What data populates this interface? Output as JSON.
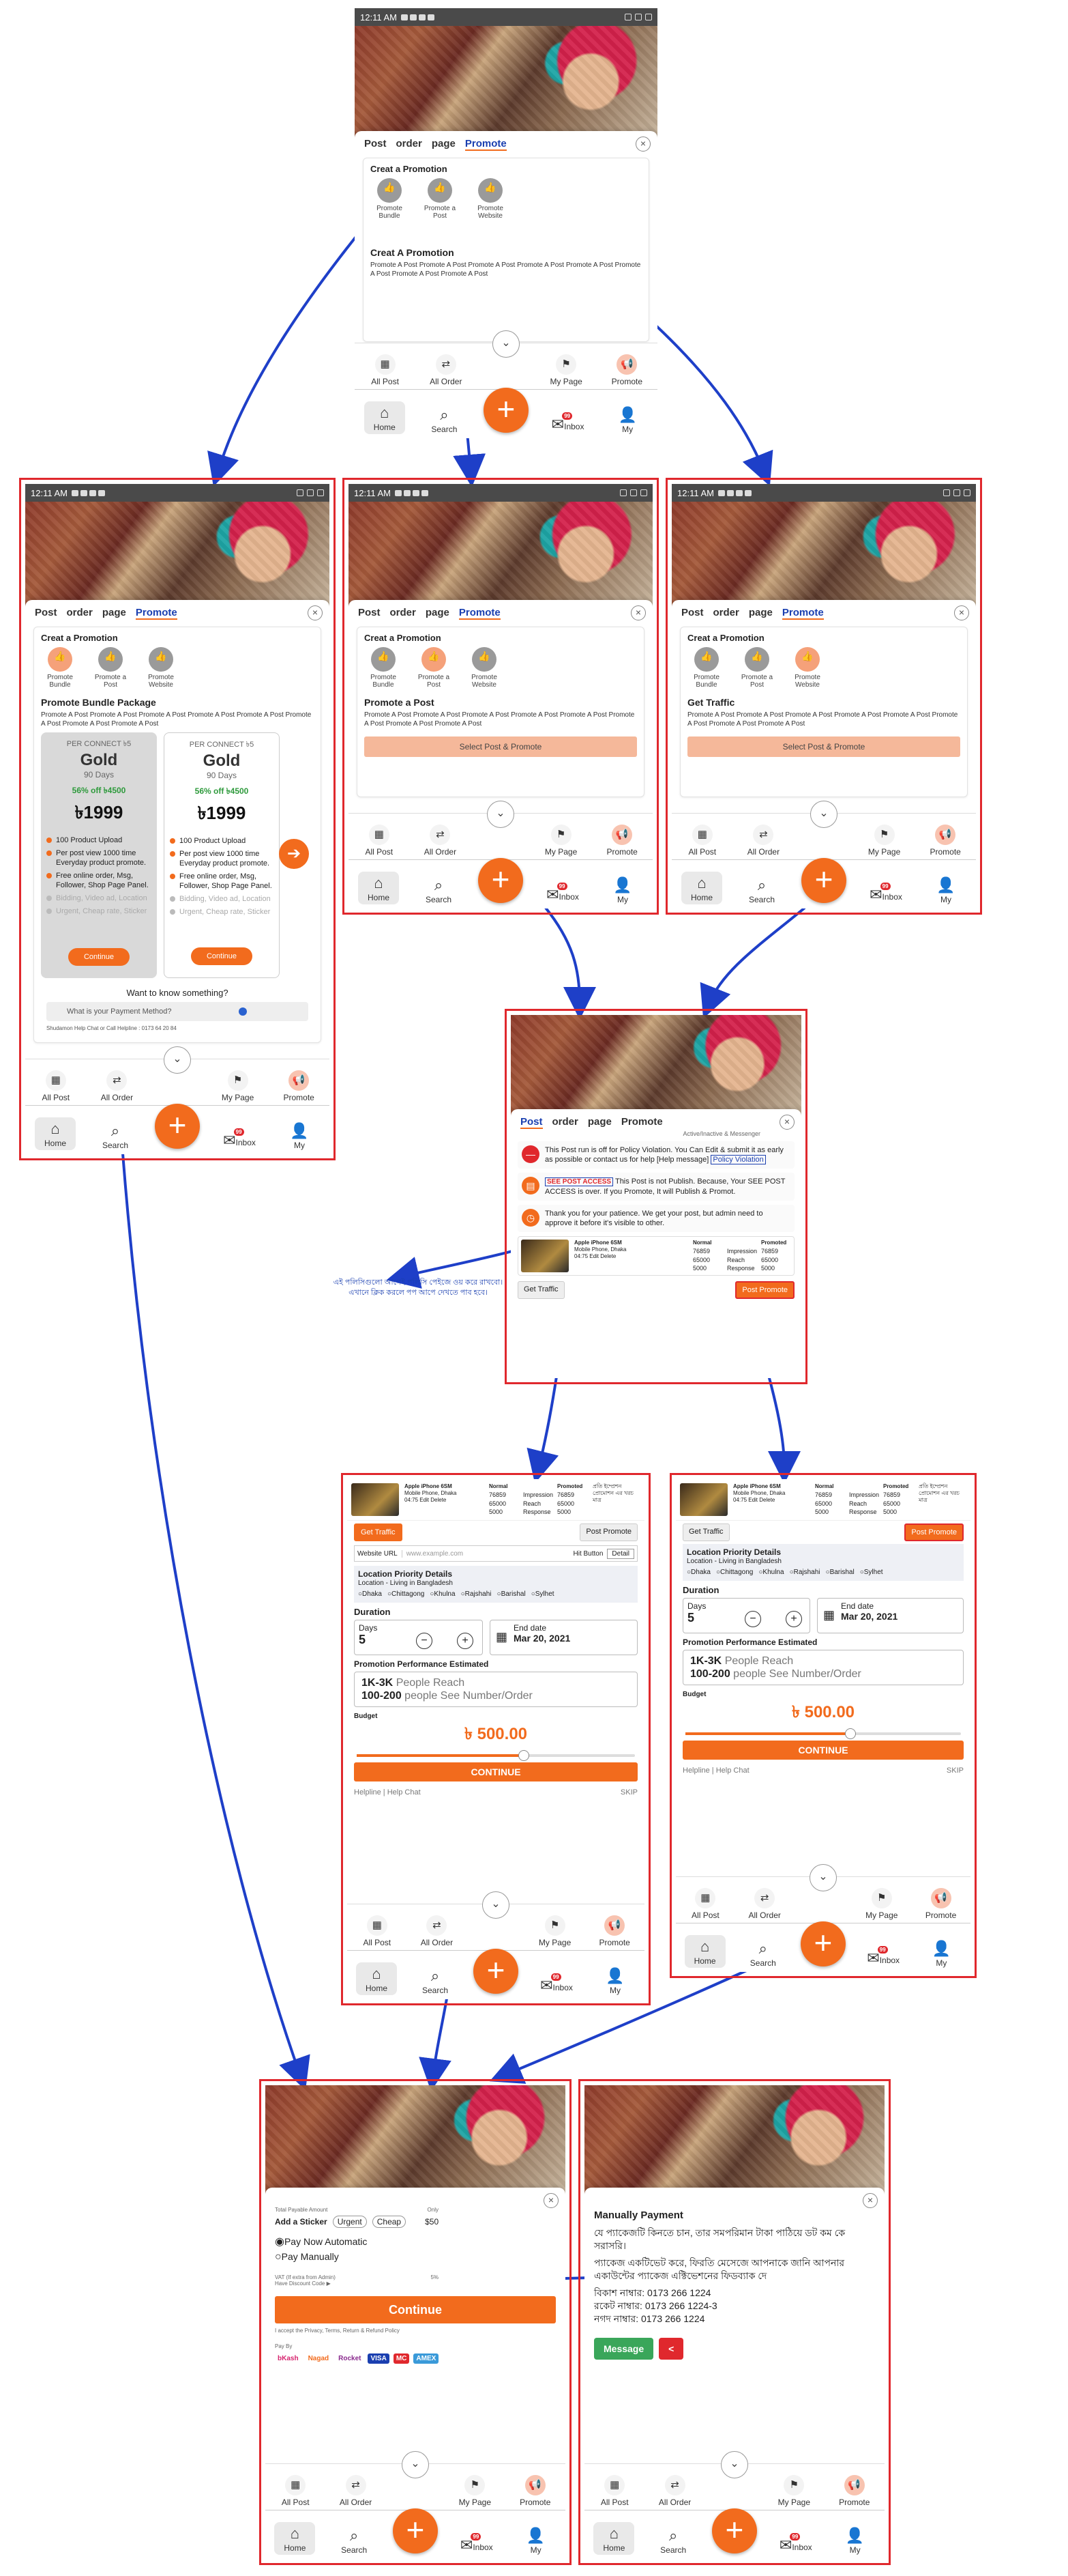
{
  "status": {
    "time": "12:11 AM"
  },
  "tabs": {
    "post": "Post",
    "order": "order",
    "page": "page",
    "promote": "Promote"
  },
  "close": "×",
  "promo": {
    "header": "Creat a Promotion",
    "opt1": "Promote Bundle",
    "opt2": "Promote a Post",
    "opt3": "Promote Website",
    "top_title": "Creat A Promotion",
    "post_title": "Promote a Post",
    "traffic_title": "Get Traffic",
    "bundle_title": "Promote Bundle Package",
    "lorem": "Promote A Post Promote A Post Promote A Post Promote A Post Promote A Post Promote A Post Promote A Post Promote A Post",
    "select_btn": "Select Post & Promote"
  },
  "bundle": {
    "per": "PER CONNECT ৳5",
    "name": "Gold",
    "days": "90 Days",
    "off": "56% off ৳4500",
    "price": "৳1999",
    "f1": "100 Product Upload",
    "f2": "Per post view 1000 time Everyday product promote.",
    "f3": "Free online order, Msg, Follower, Shop Page Panel.",
    "f4": "Bidding, Video ad, Location",
    "f5": "Urgent, Cheap rate, Sticker",
    "continue": "Continue",
    "know": "Want to know something?",
    "question": "What is your Payment Method?",
    "help": "Shudamon Help Chat  or Call Helpline : 0173 64 20 84"
  },
  "nav": {
    "allpost": "All Post",
    "allorder": "All Order",
    "mypage": "My Page",
    "promote": "Promote",
    "home": "Home",
    "search": "Search",
    "inbox": "Inbox",
    "my": "My",
    "plus": "+",
    "chev": "⌄",
    "badge": "99"
  },
  "policy": {
    "row1": "This Post run is off for Policy Violation. You Can Edit & submit it as early as possible or contact us for help [Help message]",
    "tag1": "Policy Violation",
    "note": "Active/Inactive & Messenger",
    "row2": "This Post is not Publish. Because, Your SEE POST ACCESS is over. If you Promote, It will Publish & Promot.",
    "tag2": "SEE POST ACCESS",
    "row3": "Thank you for your patience. We get your post, but admin need to approve it before it's visible to other.",
    "item_title": "Apple iPhone 6SM",
    "item_sub": "Mobile Phone, Dhaka",
    "item_time": "04:75 Edit  Delete",
    "normal": "Normal",
    "promoted": "Promoted",
    "impression": "Impression",
    "reach": "Reach",
    "response": "Response",
    "n1": "76859",
    "n2": "65000",
    "n3": "5000",
    "get_traffic": "Get Traffic",
    "post_promote": "Post Promote"
  },
  "bn_note": "এই পলিসিগুলো আগেই পলিসি পেইজে ওয় করে রাখবো। এখানে ক্লিক করলে পপ আপে দেখতে পাব হবে।",
  "bn_side": "প্রতি ইম্প্রেশন প্রোমোশন এর খরচ মাত্র",
  "budget": {
    "website_url": "Website URL",
    "url_ph": "www.example.com",
    "hit_button": "Hit Button",
    "detail": "Detail",
    "loc_title": "Location Priority Details",
    "loc_sub": "Location - Living in Bangladesh",
    "l1": "Dhaka",
    "l2": "Chittagong",
    "l3": "Khulna",
    "l4": "Rajshahi",
    "l5": "Barishal",
    "l6": "Sylhet",
    "duration": "Duration",
    "days": "Days",
    "days_val": "5",
    "end_date": "End date",
    "end_val": "Mar 20, 2021",
    "est_title": "Promotion Performance Estimated",
    "est1": "1K-3K",
    "est1b": "People Reach",
    "est2": "100-200",
    "est2b": "people See Number/Order",
    "budget_lbl": "Budget",
    "amount": "৳ 500.00",
    "continue": "CONTINUE",
    "helpline": "Helpline",
    "helpchat": "Help Chat",
    "skip": "SKIP",
    "minus": "−",
    "plus": "+"
  },
  "payment": {
    "total_label": "Total Payable Amount",
    "vat": "Only",
    "add_sticker": "Add a Sticker",
    "urgent": "Urgent",
    "cheap": "Cheap",
    "cost": "$50",
    "auto": "Pay Now Automatic",
    "manual": "Pay Manually",
    "vat2": "VAT (If extra from Admin)",
    "pct": "5%",
    "discount": "Have Discount Code ▶",
    "continue": "Continue",
    "accept": "I accept the Privacy, Terms, Return & Refund Policy",
    "payby": "Pay By",
    "m1": "bKash",
    "m2": "Nagad",
    "m3": "Rocket",
    "m4": "VISA",
    "m5": "MC",
    "m6": "AMEX"
  },
  "manual": {
    "title": "Manually Payment",
    "l1": "যে প্যাকেজটি কিনতে চান, তার সমপরিমান টাকা পাঠিয়ে ডট কম কে সরাসরি।",
    "l2": "প্যাকেজ একটিভেট করে, ফিরতি মেসেজে আপনাকে জানি আপনার একাউন্টের প্যাকেজ এক্টিভেশনের ফিডব্যাক দে",
    "l3": "বিকাশ নাম্বার: 0173 266 1224",
    "l4": "রকেট নাম্বার: 0173 266 1224-3",
    "l5": "নগদ নাম্বার: 0173 266 1224",
    "message": "Message",
    "back": "<"
  },
  "colors": {
    "accent": "#f26b1d",
    "frame": "#e0282d",
    "arrow": "#1e3fc8",
    "link": "#1a3fb0"
  }
}
